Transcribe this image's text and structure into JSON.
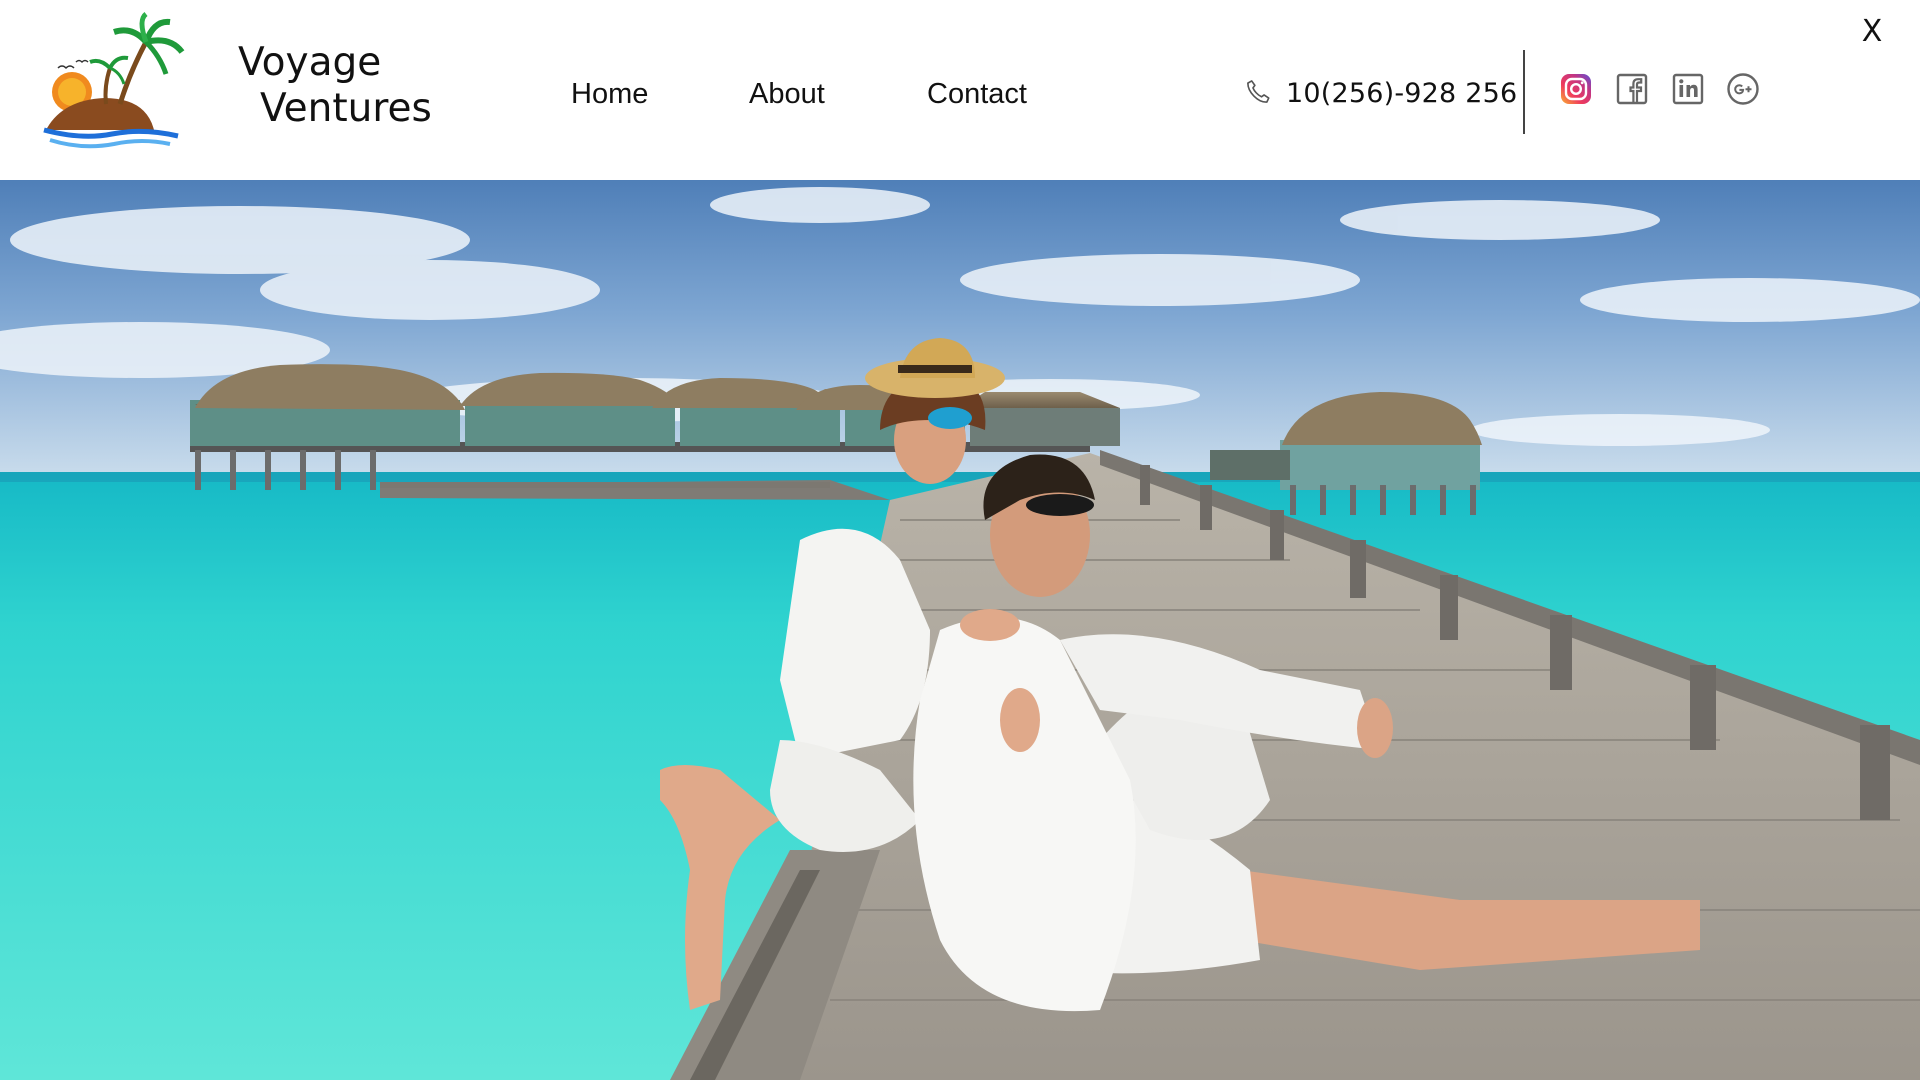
{
  "brand": {
    "line1": "Voyage",
    "line2": "Ventures",
    "logo_icon": "palm-island-sunset-logo"
  },
  "nav": {
    "items": [
      {
        "label": "Home"
      },
      {
        "label": "About"
      },
      {
        "label": "Contact"
      }
    ]
  },
  "contact": {
    "phone": "10(256)-928 256",
    "phone_icon": "phone-icon"
  },
  "social": {
    "icons": [
      "instagram-icon",
      "facebook-icon",
      "linkedin-icon",
      "google-plus-icon"
    ]
  },
  "window": {
    "close_label": "X"
  },
  "hero": {
    "image": "couple-sitting-on-overwater-jetty-maldives"
  },
  "colors": {
    "sea": "#2fd3cf",
    "sky": "#5d8fc4",
    "deck": "#a9a39a",
    "text": "#111111"
  }
}
